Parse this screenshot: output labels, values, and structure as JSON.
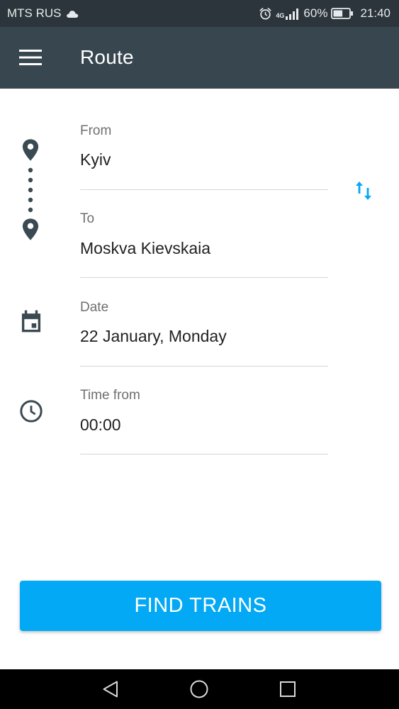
{
  "status_bar": {
    "carrier": "MTS RUS",
    "network": "4G",
    "battery": "60%",
    "battery_level": 0.6,
    "time": "21:40",
    "icons": [
      "cloud-icon",
      "alarm-icon",
      "signal-icon",
      "battery-icon"
    ]
  },
  "app_bar": {
    "title": "Route",
    "menu_icon": "hamburger-menu-icon"
  },
  "form": {
    "from": {
      "label": "From",
      "value": "Kyiv",
      "icon": "location-pin-icon"
    },
    "to": {
      "label": "To",
      "value": "Moskva Kievskaia",
      "icon": "location-pin-icon"
    },
    "swap_icon": "swap-vertical-icon",
    "date": {
      "label": "Date",
      "value": "22 January, Monday",
      "icon": "calendar-icon"
    },
    "time": {
      "label": "Time from",
      "value": "00:00",
      "icon": "clock-icon"
    }
  },
  "action": {
    "find_label": "FIND TRAINS"
  },
  "nav_bar": {
    "buttons": [
      "back-icon",
      "home-icon",
      "recents-icon"
    ]
  },
  "colors": {
    "status_bar": "#2b353b",
    "app_bar": "#38474f",
    "accent": "#03a9f4",
    "icon": "#3b4a52",
    "divider": "#d6d6d6"
  }
}
